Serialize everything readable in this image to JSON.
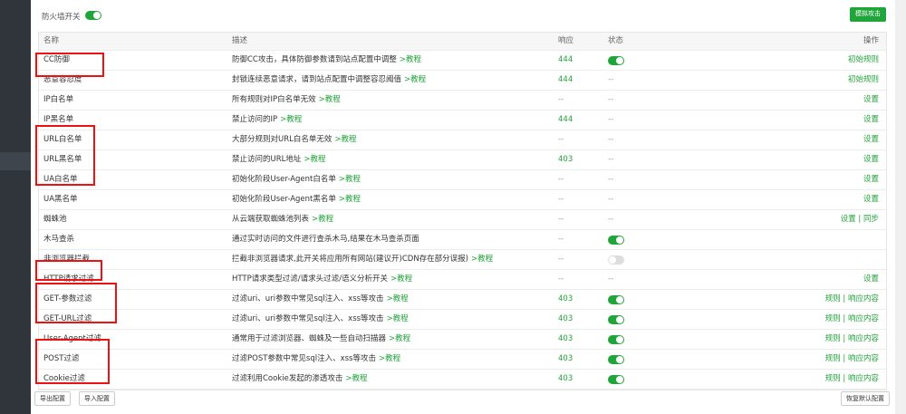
{
  "header": {
    "firewall_label": "防火墙开关",
    "simulate_button": "模拟攻击"
  },
  "table": {
    "columns": {
      "name": "名称",
      "desc": "描述",
      "resp": "响应",
      "status": "状态",
      "action": "操作"
    },
    "rows": [
      {
        "name": "CC防御",
        "desc": "防御CC攻击，具体防御参数请到站点配置中调整",
        "tutorial": ">教程",
        "resp": "444",
        "status": "on",
        "action": "初始规则"
      },
      {
        "name": "恶意容忍度",
        "desc": "封锁连续恶意请求，请到站点配置中调整容忍阈值",
        "tutorial": ">教程",
        "resp": "444",
        "status": "--",
        "action": "初始规则"
      },
      {
        "name": "IP白名单",
        "desc": "所有规则对IP白名单无效",
        "tutorial": ">教程",
        "resp": "--",
        "status": "--",
        "action": "设置"
      },
      {
        "name": "IP黑名单",
        "desc": "禁止访问的IP",
        "tutorial": ">教程",
        "resp": "444",
        "status": "--",
        "action": "设置"
      },
      {
        "name": "URL白名单",
        "desc": "大部分规则对URL白名单无效",
        "tutorial": ">教程",
        "resp": "--",
        "status": "--",
        "action": "设置"
      },
      {
        "name": "URL黑名单",
        "desc": "禁止访问的URL地址",
        "tutorial": ">教程",
        "resp": "403",
        "status": "--",
        "action": "设置"
      },
      {
        "name": "UA白名单",
        "desc": "初始化阶段User-Agent白名单",
        "tutorial": ">教程",
        "resp": "--",
        "status": "--",
        "action": "设置"
      },
      {
        "name": "UA黑名单",
        "desc": "初始化阶段User-Agent黑名单",
        "tutorial": ">教程",
        "resp": "--",
        "status": "--",
        "action": "设置"
      },
      {
        "name": "蜘蛛池",
        "desc": "从云端获取蜘蛛池列表",
        "tutorial": ">教程",
        "resp": "--",
        "status": "--",
        "action": "设置 | 同步"
      },
      {
        "name": "木马查杀",
        "desc": "通过实时访问的文件进行查杀木马,结果在木马查杀页面",
        "tutorial": "",
        "resp": "--",
        "status": "on",
        "action": ""
      },
      {
        "name": "非浏览器拦截",
        "desc": "拦截非浏览器请求,此开关将应用所有网站(建议开)CDN存在部分误报)",
        "tutorial": ">教程",
        "resp": "--",
        "status": "off",
        "action": ""
      },
      {
        "name": "HTTP请求过滤",
        "desc": "HTTP请求类型过滤/请求头过滤/语义分析开关",
        "tutorial": ">教程",
        "resp": "--",
        "status": "--",
        "action": "设置"
      },
      {
        "name": "GET-参数过滤",
        "desc": "过滤uri、uri参数中常见sql注入、xss等攻击",
        "tutorial": ">教程",
        "resp": "403",
        "status": "on",
        "action": "规则 | 响应内容"
      },
      {
        "name": "GET-URL过滤",
        "desc": "过滤uri、uri参数中常见sql注入、xss等攻击",
        "tutorial": ">教程",
        "resp": "403",
        "status": "on",
        "action": "规则 | 响应内容"
      },
      {
        "name": "User-Agent过滤",
        "desc": "通常用于过滤浏览器、蜘蛛及一些自动扫描器",
        "tutorial": ">教程",
        "resp": "403",
        "status": "on",
        "action": "规则 | 响应内容"
      },
      {
        "name": "POST过滤",
        "desc": "过滤POST参数中常见sql注入、xss等攻击",
        "tutorial": ">教程",
        "resp": "403",
        "status": "on",
        "action": "规则 | 响应内容"
      },
      {
        "name": "Cookie过滤",
        "desc": "过滤利用Cookie发起的渗透攻击",
        "tutorial": ">教程",
        "resp": "403",
        "status": "on",
        "action": "规则 | 响应内容"
      }
    ]
  },
  "footer": {
    "export_button": "导出配置",
    "import_button": "导入配置",
    "restore_button": "恢复默认配置"
  }
}
